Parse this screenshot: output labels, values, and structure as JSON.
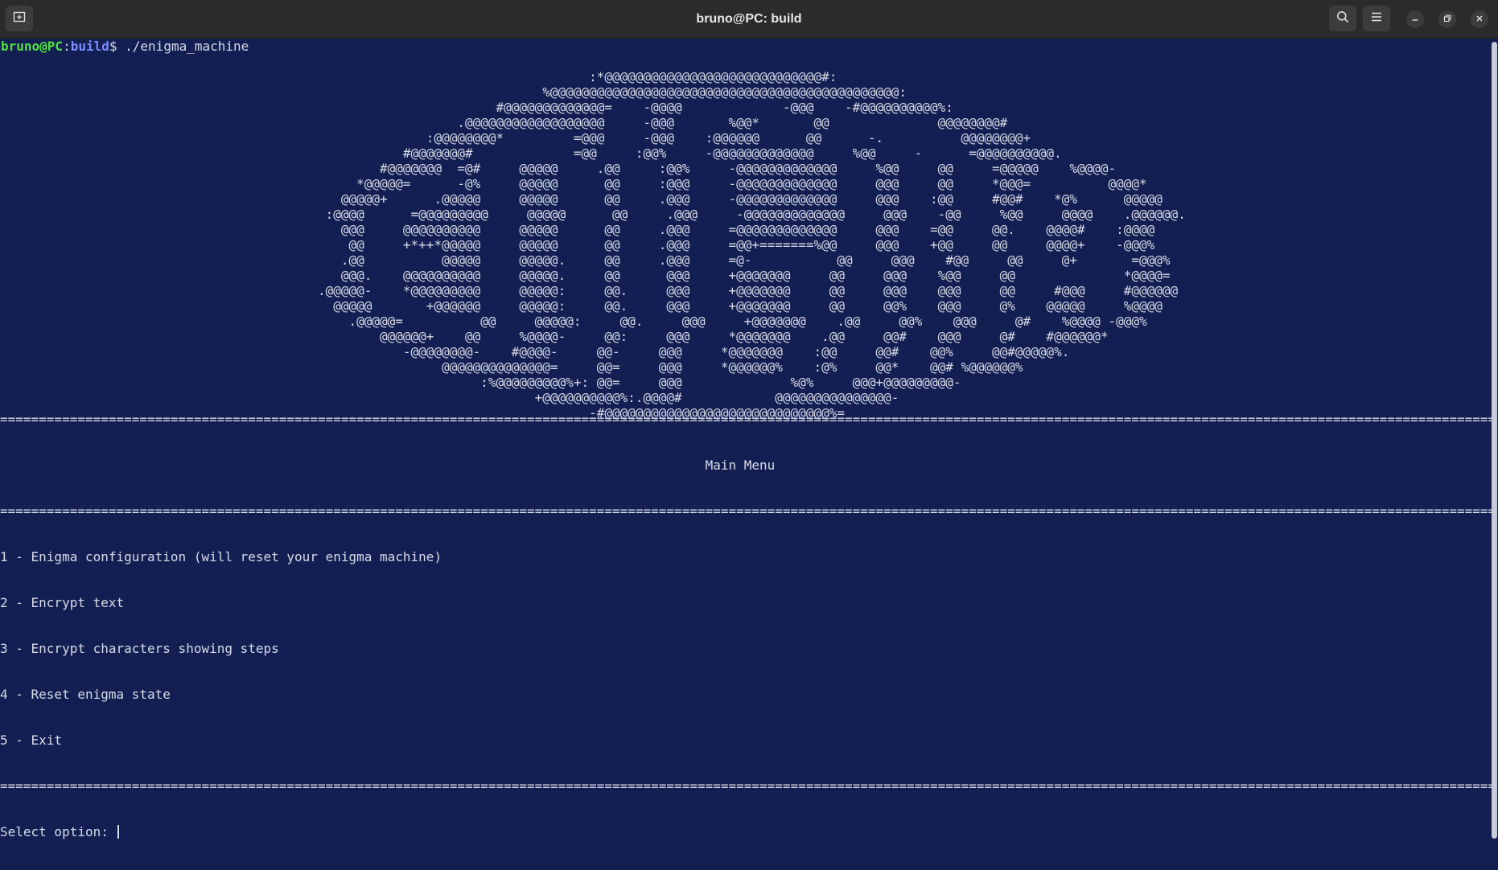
{
  "window": {
    "title": "bruno@PC: build",
    "icons": {
      "new_tab": "new-tab-icon",
      "search": "search-icon",
      "menu": "hamburger-menu-icon",
      "minimize": "minimize-icon",
      "maximize": "maximize-icon",
      "close": "close-icon"
    }
  },
  "prompt": {
    "user_host": "bruno@PC",
    "separator": ":",
    "path": "build",
    "symbol": "$",
    "command": " ./enigma_machine"
  },
  "ascii_art": [
    "                                                                            :*@@@@@@@@@@@@@@@@@@@@@@@@@@@@#:",
    "                                                                      %@@@@@@@@@@@@@@@@@@@@@@@@@@@@@@@@@@@@@@@@@@@@@:",
    "                                                                #@@@@@@@@@@@@@=    -@@@@             -@@@    -#@@@@@@@@@@%:",
    "                                                           .@@@@@@@@@@@@@@@@@@     -@@@       %@@*       @@              @@@@@@@@#",
    "                                                       :@@@@@@@@*         =@@@     -@@@    :@@@@@@      @@      -.          @@@@@@@@+",
    "                                                    #@@@@@@@#             =@@     :@@%     -@@@@@@@@@@@@@     %@@     -      =@@@@@@@@@@.",
    "                                                 #@@@@@@@  =@#     @@@@@     .@@     :@@%     -@@@@@@@@@@@@@     %@@     @@     =@@@@@    %@@@@-",
    "                                              *@@@@@=      -@%     @@@@@      @@     :@@@     -@@@@@@@@@@@@@     @@@     @@     *@@@=          @@@@*",
    "                                            @@@@@+      .@@@@@     @@@@@      @@     .@@@     -@@@@@@@@@@@@@     @@@    :@@     #@@#    *@%      @@@@@",
    "                                          :@@@@      =@@@@@@@@@     @@@@@      @@     .@@@     -@@@@@@@@@@@@@     @@@    -@@     %@@     @@@@    .@@@@@@.",
    "                                            @@@     @@@@@@@@@@     @@@@@      @@     .@@@     =@@@@@@@@@@@@@     @@@    =@@     @@.    @@@@#    :@@@@",
    "                                             @@     +*++*@@@@@     @@@@@      @@     .@@@     =@@+=======%@@     @@@    +@@     @@     @@@@+    -@@@%",
    "                                            .@@          @@@@@     @@@@@.     @@     .@@@     =@-           @@     @@@    #@@     @@     @+       =@@@%",
    "                                            @@@.    @@@@@@@@@@     @@@@@.     @@      @@@     +@@@@@@@     @@     @@@    %@@     @@              *@@@@=",
    "                                         .@@@@@-    *@@@@@@@@@     @@@@@:     @@.     @@@     +@@@@@@@     @@     @@@    @@@     @@     #@@@     #@@@@@@",
    "                                           @@@@@       +@@@@@@     @@@@@:     @@.     @@@     +@@@@@@@     @@     @@%    @@@     @%    @@@@@     %@@@@",
    "                                             .@@@@@=          @@     @@@@@:     @@.     @@@     +@@@@@@@    .@@     @@%    @@@     @#    %@@@@ -@@@%",
    "                                                 @@@@@@+    @@     %@@@@-     @@:     @@@     *@@@@@@@    .@@     @@#    @@@     @#    #@@@@@@*",
    "                                                    -@@@@@@@@-    #@@@@-     @@-     @@@     *@@@@@@@    :@@     @@#    @@%     @@#@@@@@%.",
    "                                                         @@@@@@@@@@@@@@=     @@=     @@@     *@@@@@@%    :@%     @@*    @@# %@@@@@@%",
    "                                                              :%@@@@@@@@@%+: @@=     @@@              %@%     @@@+@@@@@@@@@-",
    "                                                                     +@@@@@@@@@@%:.@@@@#            @@@@@@@@@@@@@@@-",
    "                                                                            -#@@@@@@@@@@@@@@@@@@@@@@@@@@@@@%="
  ],
  "menu": {
    "separator": "=================================================================================================================================================================================================",
    "title": "Main Menu",
    "title_line": "                                                                                           Main Menu",
    "options": [
      "1 - Enigma configuration (will reset your enigma machine)",
      "2 - Encrypt text",
      "3 - Encrypt characters showing steps",
      "4 - Reset enigma state",
      "5 - Exit"
    ],
    "input_prompt": "Select option: "
  }
}
